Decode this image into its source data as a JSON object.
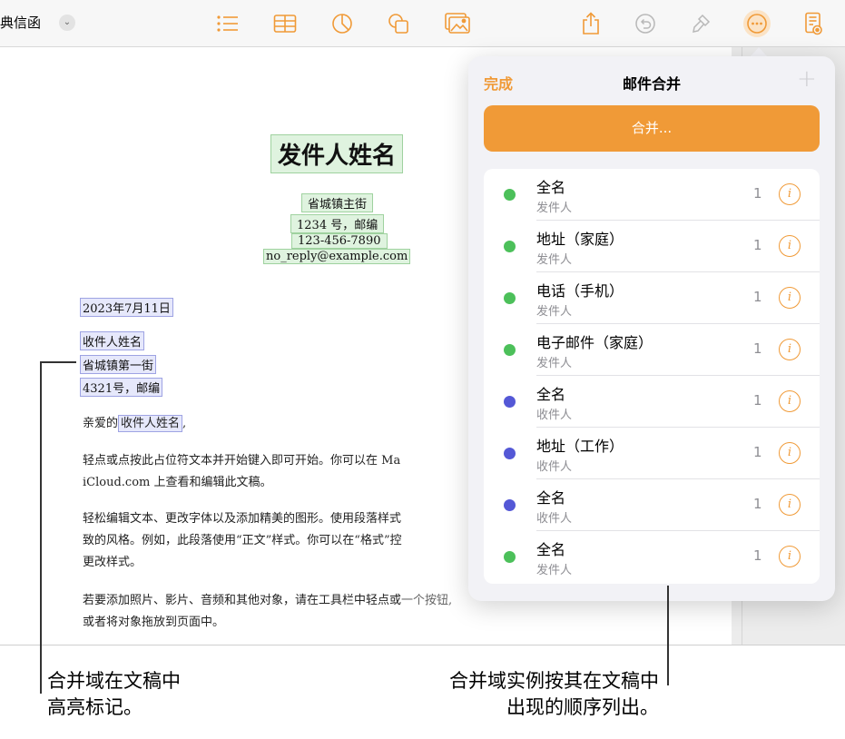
{
  "toolbar": {
    "doc_title": "典信函",
    "buttons": [
      "list-icon",
      "table-icon",
      "chart-icon",
      "shape-icon",
      "media-icon",
      "share-icon",
      "undo-icon",
      "format-brush-icon",
      "more-icon",
      "document-view-icon"
    ]
  },
  "colors": {
    "accent": "#f09a37",
    "field_green": "#dff3df",
    "field_blue": "#e6e8fb",
    "dot_green": "#4cc05a",
    "dot_blue": "#5458d6"
  },
  "document": {
    "sender_name": "发件人姓名",
    "sender_address1": "省城镇主街",
    "sender_address2": "1234 号，邮编",
    "sender_phone": "123-456-7890",
    "sender_email": "no_reply@example.com",
    "date": "2023年7月11日",
    "recipient_name": "收件人姓名",
    "recipient_address1": "省城镇第一街",
    "recipient_address2": "4321号，邮编",
    "greeting_prefix": "亲爱的",
    "greeting_field": "收件人姓名",
    "greeting_suffix": ",",
    "paragraph1_line1": "轻点或点按此占位符文本并开始键入即可开始。你可以在 Ma",
    "paragraph1_line2": "iCloud.com 上查看和编辑此文稿。",
    "paragraph2_line1": "轻松编辑文本、更改字体以及添加精美的图形。使用段落样式",
    "paragraph2_line2": "致的风格。例如，此段落使用“正文”样式。你可以在“格式”控",
    "paragraph2_line3": "更改样式。",
    "paragraph3_line1": "若要添加照片、影片、音频和其他对象，请在工具栏中轻点或",
    "paragraph3_line1_tail": "一个按钮,",
    "paragraph3_line2": "或者将对象拖放到页面中。"
  },
  "panel": {
    "done_label": "完成",
    "title": "邮件合并",
    "add_label": "+",
    "merge_button_label": "合并...",
    "fields": [
      {
        "title": "全名",
        "subtitle": "发件人",
        "count": "1",
        "color": "green"
      },
      {
        "title": "地址（家庭）",
        "subtitle": "发件人",
        "count": "1",
        "color": "green"
      },
      {
        "title": "电话（手机）",
        "subtitle": "发件人",
        "count": "1",
        "color": "green"
      },
      {
        "title": "电子邮件（家庭）",
        "subtitle": "发件人",
        "count": "1",
        "color": "green"
      },
      {
        "title": "全名",
        "subtitle": "收件人",
        "count": "1",
        "color": "blue"
      },
      {
        "title": "地址（工作）",
        "subtitle": "收件人",
        "count": "1",
        "color": "blue"
      },
      {
        "title": "全名",
        "subtitle": "收件人",
        "count": "1",
        "color": "blue"
      },
      {
        "title": "全名",
        "subtitle": "发件人",
        "count": "1",
        "color": "green"
      }
    ],
    "info_glyph": "i"
  },
  "callouts": {
    "left_line1": "合并域在文稿中",
    "left_line2": "高亮标记。",
    "right_line1": "合并域实例按其在文稿中",
    "right_line2": "出现的顺序列出。"
  }
}
